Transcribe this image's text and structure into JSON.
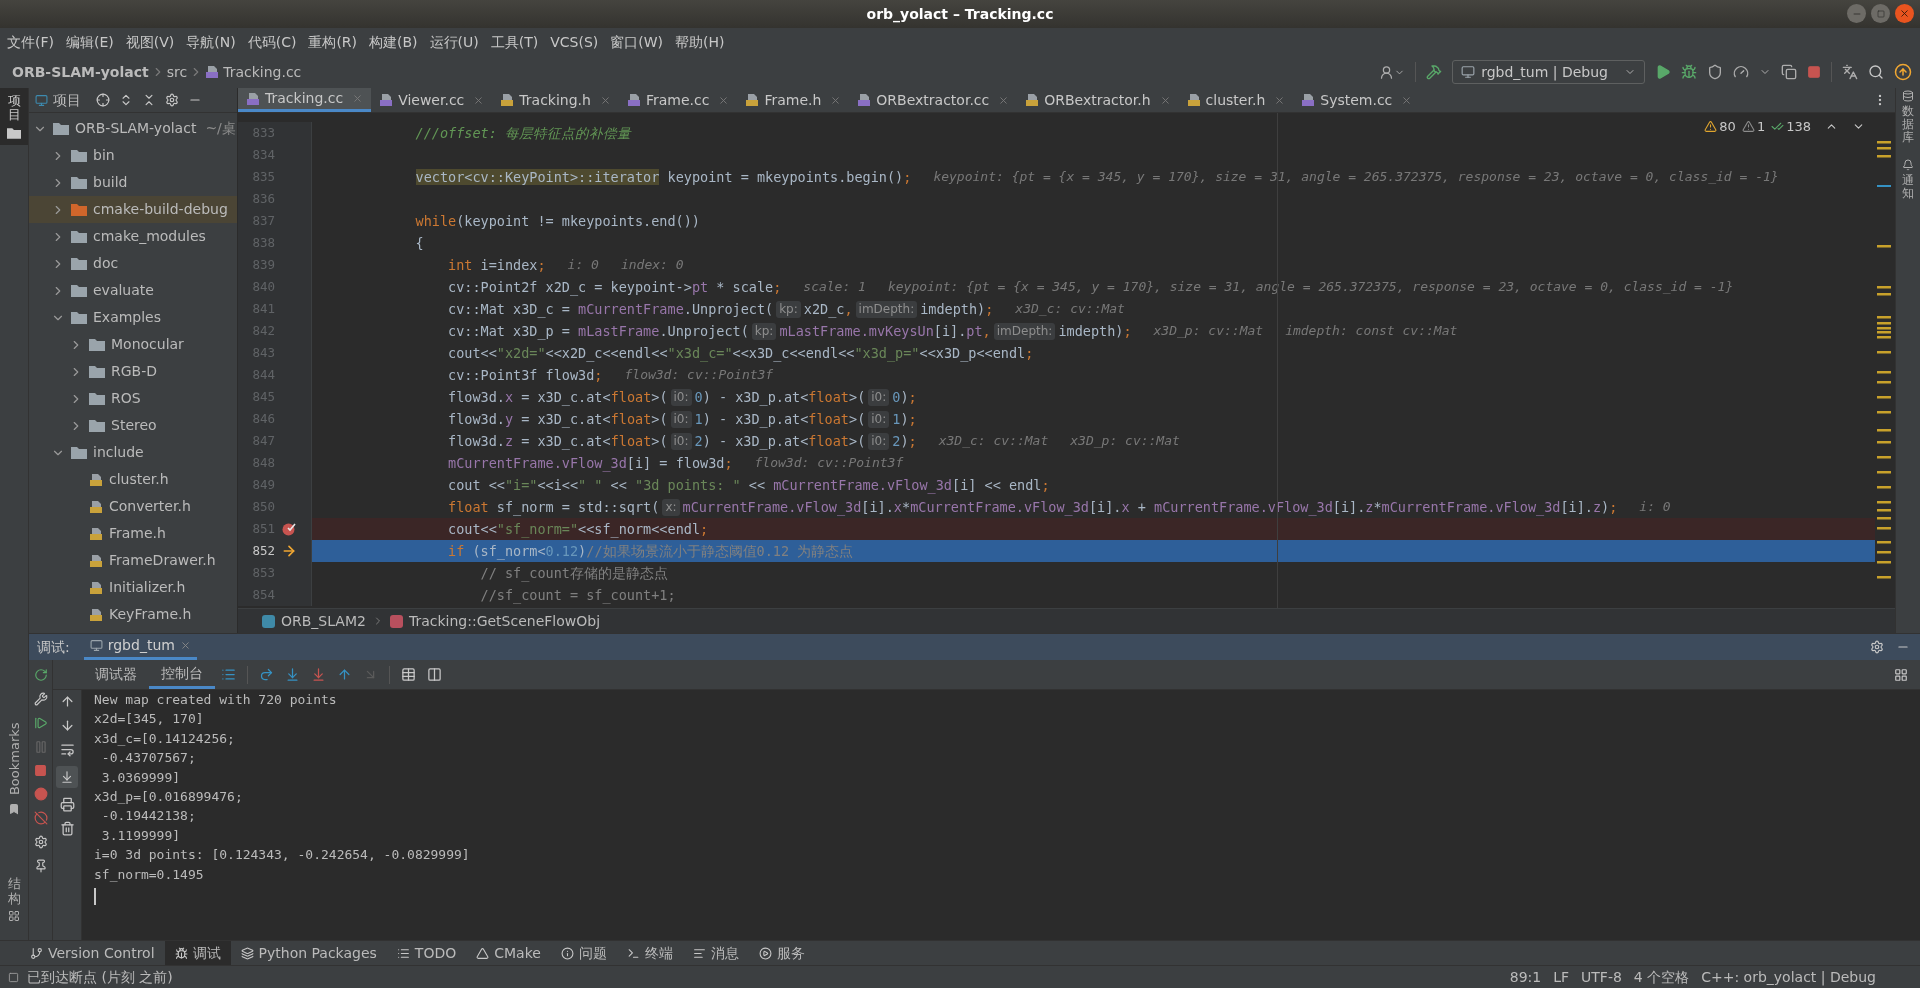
{
  "window": {
    "title": "orb_yolact – Tracking.cc"
  },
  "menu": [
    "文件(F)",
    "编辑(E)",
    "视图(V)",
    "导航(N)",
    "代码(C)",
    "重构(R)",
    "构建(B)",
    "运行(U)",
    "工具(T)",
    "VCS(S)",
    "窗口(W)",
    "帮助(H)"
  ],
  "navbar": {
    "breadcrumb": [
      {
        "label": "ORB-SLAM-yolact",
        "kind": "project"
      },
      {
        "label": "src",
        "kind": "folder"
      },
      {
        "label": "Tracking.cc",
        "kind": "cpp"
      }
    ],
    "run_config": "rgbd_tum | Debug"
  },
  "left_stripe": {
    "top": [
      {
        "label": "项目",
        "selected": true
      }
    ],
    "bottom": [
      {
        "label": "Bookmarks",
        "kind": "latin"
      },
      {
        "label": "结构",
        "kind": "cjk"
      }
    ]
  },
  "project_panel": {
    "title": "项目",
    "tree": [
      {
        "label": "ORB-SLAM-yolact",
        "note": "~/桌",
        "kind": "root",
        "expanded": true,
        "selected": false,
        "children": [
          {
            "label": "bin",
            "kind": "folder",
            "expanded": false,
            "selected": false
          },
          {
            "label": "build",
            "kind": "folder",
            "expanded": false,
            "selected": false
          },
          {
            "label": "cmake-build-debug",
            "kind": "excluded",
            "expanded": false,
            "selected": true
          },
          {
            "label": "cmake_modules",
            "kind": "folder",
            "expanded": false,
            "selected": false
          },
          {
            "label": "doc",
            "kind": "folder",
            "expanded": false,
            "selected": false
          },
          {
            "label": "evaluate",
            "kind": "folder",
            "expanded": false,
            "selected": false
          },
          {
            "label": "Examples",
            "kind": "folder",
            "expanded": true,
            "selected": false,
            "children": [
              {
                "label": "Monocular",
                "kind": "folder",
                "expanded": false,
                "selected": false
              },
              {
                "label": "RGB-D",
                "kind": "folder",
                "expanded": false,
                "selected": false
              },
              {
                "label": "ROS",
                "kind": "folder",
                "expanded": false,
                "selected": false
              },
              {
                "label": "Stereo",
                "kind": "folder",
                "expanded": false,
                "selected": false
              }
            ]
          },
          {
            "label": "include",
            "kind": "folder",
            "expanded": true,
            "selected": false,
            "children": [
              {
                "label": "cluster.h",
                "kind": "header",
                "selected": false
              },
              {
                "label": "Converter.h",
                "kind": "header",
                "selected": false
              },
              {
                "label": "Frame.h",
                "kind": "header",
                "selected": false
              },
              {
                "label": "FrameDrawer.h",
                "kind": "header",
                "selected": false
              },
              {
                "label": "Initializer.h",
                "kind": "header",
                "selected": false
              },
              {
                "label": "KeyFrame.h",
                "kind": "header",
                "selected": false
              }
            ]
          }
        ]
      }
    ]
  },
  "editor": {
    "tabs": [
      {
        "label": "Tracking.cc",
        "kind": "cpp",
        "selected": true
      },
      {
        "label": "Viewer.cc",
        "kind": "cpp",
        "selected": false
      },
      {
        "label": "Tracking.h",
        "kind": "header",
        "selected": false
      },
      {
        "label": "Frame.cc",
        "kind": "cpp",
        "selected": false
      },
      {
        "label": "Frame.h",
        "kind": "header",
        "selected": false
      },
      {
        "label": "ORBextractor.cc",
        "kind": "cpp",
        "selected": false
      },
      {
        "label": "ORBextractor.h",
        "kind": "header",
        "selected": false
      },
      {
        "label": "cluster.h",
        "kind": "header",
        "selected": false
      },
      {
        "label": "System.cc",
        "kind": "cpp",
        "selected": false
      }
    ],
    "inspections": {
      "warnings": "80",
      "weak_warnings": "1",
      "passed": "138"
    },
    "lines": [
      {
        "number": "833",
        "breakpoint": false,
        "current": false,
        "segments": [
          {
            "kind": "doc",
            "text": "            ///offset: 每层特征点的补偿量"
          }
        ]
      },
      {
        "number": "834",
        "breakpoint": false,
        "current": false
      },
      {
        "number": "835",
        "breakpoint": false,
        "current": false,
        "segments": [
          {
            "kind": "type",
            "text": "            vector<cv::KeyPoint>::iterator"
          },
          {
            "kind": "plain",
            "text": " keypoint = mkeypoints.begin()"
          },
          {
            "kind": "keyword",
            "text": ";"
          },
          {
            "kind": "inlay",
            "text": "keypoint: {pt = {x = 345, y = 170}, size = 31, angle = 265.372375, response = 23, octave = 0, class_id = -1}"
          }
        ]
      },
      {
        "number": "836",
        "breakpoint": false,
        "current": false
      },
      {
        "number": "837",
        "breakpoint": false,
        "current": false,
        "segments": [
          {
            "kind": "keyword",
            "text": "            while"
          },
          {
            "kind": "plain",
            "text": "(keypoint != mkeypoints.end())"
          }
        ]
      },
      {
        "number": "838",
        "breakpoint": false,
        "current": false,
        "segments": [
          {
            "kind": "plain",
            "text": "            {"
          }
        ]
      },
      {
        "number": "839",
        "breakpoint": false,
        "current": false,
        "segments": [
          {
            "kind": "keyword",
            "text": "                int"
          },
          {
            "kind": "plain",
            "text": " i=index"
          },
          {
            "kind": "keyword",
            "text": ";"
          },
          {
            "kind": "inlay",
            "text": "i: 0"
          },
          {
            "kind": "inlay",
            "text": "index: 0"
          }
        ]
      },
      {
        "number": "840",
        "breakpoint": false,
        "current": false,
        "segments": [
          {
            "kind": "plain",
            "text": "                cv::Point2f x2D_c = keypoint->"
          },
          {
            "kind": "member",
            "text": "pt"
          },
          {
            "kind": "plain",
            "text": " * scale"
          },
          {
            "kind": "keyword",
            "text": ";"
          },
          {
            "kind": "inlay",
            "text": "scale: 1"
          },
          {
            "kind": "inlay",
            "text": "keypoint: {pt = {x = 345, y = 170}, size = 31, angle = 265.372375, response = 23, octave = 0, class_id = -1}"
          }
        ]
      },
      {
        "number": "841",
        "breakpoint": false,
        "current": false,
        "segments": [
          {
            "kind": "plain",
            "text": "                cv::Mat x3D_c = "
          },
          {
            "kind": "member",
            "text": "mCurrentFrame"
          },
          {
            "kind": "plain",
            "text": ".Unproject("
          },
          {
            "kind": "hint",
            "text": "kp:"
          },
          {
            "kind": "plain",
            "text": "x2D_c"
          },
          {
            "kind": "keyword",
            "text": ","
          },
          {
            "kind": "hint",
            "text": "imDepth:"
          },
          {
            "kind": "plain",
            "text": "imdepth)"
          },
          {
            "kind": "keyword",
            "text": ";"
          },
          {
            "kind": "inlay",
            "text": "x3D_c: cv::Mat"
          }
        ]
      },
      {
        "number": "842",
        "breakpoint": false,
        "current": false,
        "segments": [
          {
            "kind": "plain",
            "text": "                cv::Mat x3D_p = "
          },
          {
            "kind": "member",
            "text": "mLastFrame"
          },
          {
            "kind": "plain",
            "text": ".Unproject("
          },
          {
            "kind": "hint",
            "text": "kp:"
          },
          {
            "kind": "member",
            "text": "mLastFrame.mvKeysUn"
          },
          {
            "kind": "plain",
            "text": "[i]."
          },
          {
            "kind": "member",
            "text": "pt"
          },
          {
            "kind": "keyword",
            "text": ","
          },
          {
            "kind": "hint",
            "text": "imDepth:"
          },
          {
            "kind": "plain",
            "text": "imdepth)"
          },
          {
            "kind": "keyword",
            "text": ";"
          },
          {
            "kind": "inlay",
            "text": "x3D_p: cv::Mat"
          },
          {
            "kind": "inlay",
            "text": "imdepth: const cv::Mat"
          }
        ]
      },
      {
        "number": "843",
        "breakpoint": false,
        "current": false,
        "segments": [
          {
            "kind": "plain",
            "text": "                cout<<"
          },
          {
            "kind": "string",
            "text": "\"x2d=\""
          },
          {
            "kind": "plain",
            "text": "<<x2D_c<<endl<<"
          },
          {
            "kind": "string",
            "text": "\"x3d_c=\""
          },
          {
            "kind": "plain",
            "text": "<<x3D_c<<endl<<"
          },
          {
            "kind": "string",
            "text": "\"x3d_p=\""
          },
          {
            "kind": "plain",
            "text": "<<x3D_p<<endl"
          },
          {
            "kind": "keyword",
            "text": ";"
          }
        ]
      },
      {
        "number": "844",
        "breakpoint": false,
        "current": false,
        "segments": [
          {
            "kind": "plain",
            "text": "                cv::Point3f flow3d"
          },
          {
            "kind": "keyword",
            "text": ";"
          },
          {
            "kind": "inlay",
            "text": "flow3d: cv::Point3f"
          }
        ]
      },
      {
        "number": "845",
        "breakpoint": false,
        "current": false,
        "segments": [
          {
            "kind": "plain",
            "text": "                flow3d."
          },
          {
            "kind": "member",
            "text": "x"
          },
          {
            "kind": "plain",
            "text": " = x3D_c.at<"
          },
          {
            "kind": "keyword",
            "text": "float"
          },
          {
            "kind": "plain",
            "text": ">("
          },
          {
            "kind": "hint",
            "text": "i0:"
          },
          {
            "kind": "number",
            "text": "0"
          },
          {
            "kind": "plain",
            "text": ") - x3D_p.at<"
          },
          {
            "kind": "keyword",
            "text": "float"
          },
          {
            "kind": "plain",
            "text": ">("
          },
          {
            "kind": "hint",
            "text": "i0:"
          },
          {
            "kind": "number",
            "text": "0"
          },
          {
            "kind": "plain",
            "text": ")"
          },
          {
            "kind": "keyword",
            "text": ";"
          }
        ]
      },
      {
        "number": "846",
        "breakpoint": false,
        "current": false,
        "segments": [
          {
            "kind": "plain",
            "text": "                flow3d."
          },
          {
            "kind": "member",
            "text": "y"
          },
          {
            "kind": "plain",
            "text": " = x3D_c.at<"
          },
          {
            "kind": "keyword",
            "text": "float"
          },
          {
            "kind": "plain",
            "text": ">("
          },
          {
            "kind": "hint",
            "text": "i0:"
          },
          {
            "kind": "number",
            "text": "1"
          },
          {
            "kind": "plain",
            "text": ") - x3D_p.at<"
          },
          {
            "kind": "keyword",
            "text": "float"
          },
          {
            "kind": "plain",
            "text": ">("
          },
          {
            "kind": "hint",
            "text": "i0:"
          },
          {
            "kind": "number",
            "text": "1"
          },
          {
            "kind": "plain",
            "text": ")"
          },
          {
            "kind": "keyword",
            "text": ";"
          }
        ]
      },
      {
        "number": "847",
        "breakpoint": false,
        "current": false,
        "segments": [
          {
            "kind": "plain",
            "text": "                flow3d."
          },
          {
            "kind": "member",
            "text": "z"
          },
          {
            "kind": "plain",
            "text": " = x3D_c.at<"
          },
          {
            "kind": "keyword",
            "text": "float"
          },
          {
            "kind": "plain",
            "text": ">("
          },
          {
            "kind": "hint",
            "text": "i0:"
          },
          {
            "kind": "number",
            "text": "2"
          },
          {
            "kind": "plain",
            "text": ") - x3D_p.at<"
          },
          {
            "kind": "keyword",
            "text": "float"
          },
          {
            "kind": "plain",
            "text": ">("
          },
          {
            "kind": "hint",
            "text": "i0:"
          },
          {
            "kind": "number",
            "text": "2"
          },
          {
            "kind": "plain",
            "text": ")"
          },
          {
            "kind": "keyword",
            "text": ";"
          },
          {
            "kind": "inlay",
            "text": "x3D_c: cv::Mat"
          },
          {
            "kind": "inlay",
            "text": "x3D_p: cv::Mat"
          }
        ]
      },
      {
        "number": "848",
        "breakpoint": false,
        "current": false,
        "segments": [
          {
            "kind": "member",
            "text": "                mCurrentFrame.vFlow_3d"
          },
          {
            "kind": "plain",
            "text": "[i] = flow3d"
          },
          {
            "kind": "keyword",
            "text": ";"
          },
          {
            "kind": "inlay",
            "text": "flow3d: cv::Point3f"
          }
        ]
      },
      {
        "number": "849",
        "breakpoint": false,
        "current": false,
        "segments": [
          {
            "kind": "plain",
            "text": "                cout <<"
          },
          {
            "kind": "string",
            "text": "\"i=\""
          },
          {
            "kind": "plain",
            "text": "<<i<<"
          },
          {
            "kind": "string",
            "text": "\" \""
          },
          {
            "kind": "plain",
            "text": " << "
          },
          {
            "kind": "string",
            "text": "\"3d points: \""
          },
          {
            "kind": "plain",
            "text": " << "
          },
          {
            "kind": "member",
            "text": "mCurrentFrame.vFlow_3d"
          },
          {
            "kind": "plain",
            "text": "[i] << endl"
          },
          {
            "kind": "keyword",
            "text": ";"
          }
        ]
      },
      {
        "number": "850",
        "breakpoint": false,
        "current": false,
        "segments": [
          {
            "kind": "keyword",
            "text": "                float"
          },
          {
            "kind": "plain",
            "text": " sf_norm = std::sqrt("
          },
          {
            "kind": "hint",
            "text": "x:"
          },
          {
            "kind": "member",
            "text": "mCurrentFrame.vFlow_3d"
          },
          {
            "kind": "plain",
            "text": "[i]."
          },
          {
            "kind": "member",
            "text": "x"
          },
          {
            "kind": "plain",
            "text": "*"
          },
          {
            "kind": "member",
            "text": "mCurrentFrame.vFlow_3d"
          },
          {
            "kind": "plain",
            "text": "[i]."
          },
          {
            "kind": "member",
            "text": "x"
          },
          {
            "kind": "plain",
            "text": " + "
          },
          {
            "kind": "member",
            "text": "mCurrentFrame.vFlow_3d"
          },
          {
            "kind": "plain",
            "text": "[i]."
          },
          {
            "kind": "member",
            "text": "z"
          },
          {
            "kind": "plain",
            "text": "*"
          },
          {
            "kind": "member",
            "text": "mCurrentFrame.vFlow_3d"
          },
          {
            "kind": "plain",
            "text": "[i]."
          },
          {
            "kind": "member",
            "text": "z"
          },
          {
            "kind": "plain",
            "text": ")"
          },
          {
            "kind": "keyword",
            "text": ";"
          },
          {
            "kind": "inlay",
            "text": "i: 0"
          }
        ]
      },
      {
        "number": "851",
        "breakpoint": true,
        "current": false,
        "segments": [
          {
            "kind": "plain",
            "text": "                cout<<"
          },
          {
            "kind": "string",
            "text": "\"sf_norm=\""
          },
          {
            "kind": "plain",
            "text": "<<sf_norm<<endl"
          },
          {
            "kind": "keyword",
            "text": ";"
          }
        ]
      },
      {
        "number": "852",
        "breakpoint": false,
        "current": true,
        "segments": [
          {
            "kind": "keyword",
            "text": "                if"
          },
          {
            "kind": "plain",
            "text": " (sf_norm<"
          },
          {
            "kind": "number",
            "text": "0.12"
          },
          {
            "kind": "plain",
            "text": ")"
          },
          {
            "kind": "comment",
            "text": "//如果场景流小于静态阈值0.12 为静态点"
          }
        ]
      },
      {
        "number": "853",
        "breakpoint": false,
        "current": false,
        "segments": [
          {
            "kind": "comment",
            "text": "                    // sf_count存储的是静态点"
          }
        ]
      },
      {
        "number": "854",
        "breakpoint": false,
        "current": false,
        "segments": [
          {
            "kind": "comment",
            "text": "                    //sf_count = sf_count+1;"
          }
        ]
      }
    ],
    "breadcrumb": [
      {
        "label": "ORB_SLAM2",
        "kind": "namespace"
      },
      {
        "label": "Tracking::GetSceneFlowObj",
        "kind": "function"
      }
    ]
  },
  "right_stripe": [
    {
      "label": "数据库",
      "kind": "database"
    },
    {
      "label": "通知",
      "kind": "notifications"
    }
  ],
  "debug": {
    "label": "调试:",
    "sessions": [
      {
        "label": "rgbd_tum",
        "selected": true
      }
    ],
    "tabs": [
      {
        "label": "调试器",
        "selected": false
      },
      {
        "label": "控制台",
        "selected": true
      }
    ],
    "console": [
      "New map created with 720 points",
      "x2d=[345, 170]",
      "x3d_c=[0.14124256;",
      " -0.43707567;",
      " 3.0369999]",
      "x3d_p=[0.016899476;",
      " -0.19442138;",
      " 3.1199999]",
      "i=0 3d points: [0.124343, -0.242654, -0.0829999]",
      "sf_norm=0.1495"
    ]
  },
  "tool_tabs": [
    {
      "label": "Version Control",
      "selected": false
    },
    {
      "label": "调试",
      "selected": true
    },
    {
      "label": "Python Packages",
      "selected": false
    },
    {
      "label": "TODO",
      "selected": false
    },
    {
      "label": "CMake",
      "selected": false
    },
    {
      "label": "问题",
      "selected": false
    },
    {
      "label": "终端",
      "selected": false
    },
    {
      "label": "消息",
      "selected": false
    },
    {
      "label": "服务",
      "selected": false
    }
  ],
  "status_bar": {
    "message": "已到达断点 (片刻 之前)",
    "items": [
      "89:1",
      "LF",
      "UTF-8",
      "4 个空格",
      "C++: orb_yolact | Debug"
    ]
  }
}
